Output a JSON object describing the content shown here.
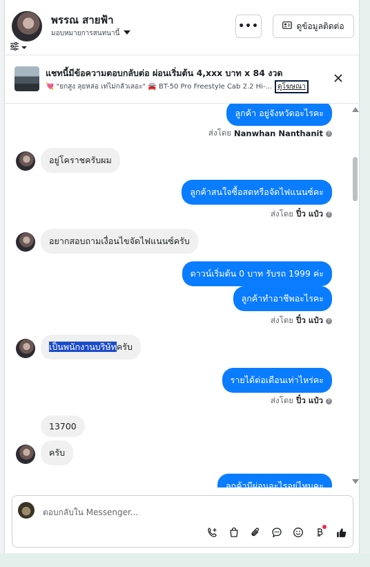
{
  "header": {
    "contact_name": "พรรณ สายฟ้า",
    "assign_label": "มอบหมายการสนทนานี้",
    "more_label": "•••",
    "contact_info_label": "ดูข้อมูลติดต่อ"
  },
  "ad_banner": {
    "title": "แชทนี้มีข้อความตอบกลับต่อ ผ่อนเริ่มต้น 4,xxx บาท x 84 งวด",
    "subtitle": "💘 \"ยกสูง ลุยหล่อ เท่ไม่กลัวเลอะ\" 🚘 BT-50 Pro Freestyle Cab 2.2 Hi-...",
    "link_label": "ดูโฆษณา"
  },
  "messages": {
    "m1": "ลูกค้า อยู่จังหวัดอะไรคะ",
    "s1_prefix": "ส่งโดย",
    "s1_name": "Nanwhan Nanthanit",
    "m2": "อยู่โคราชครับผม",
    "m3": "ลูกค้าสนใจซื้อสดหรือจัดไฟแนนซ์คะ",
    "s2_prefix": "ส่งโดย",
    "s2_name": "ปิ๋ว แป๋ว",
    "m4": "อยากสอบถามเงื่อนไขจัดไฟแนนซ์ครับ",
    "m5": "ดาวน์เริ่มต้น 0 บาท รับรถ 1999 ค่ะ",
    "m6": "ลูกค้าทำอาชีพอะไรคะ",
    "s3_prefix": "ส่งโดย",
    "s3_name": "ปิ๋ว แป๋ว",
    "m7_highlight": "เป็นพนักงานบริษัท",
    "m7_rest": "ครับ",
    "m8": "รายได้ต่อเดือนเท่าไหร่คะ",
    "s4_prefix": "ส่งโดย",
    "s4_name": "ปิ๋ว แป๋ว",
    "m9": "13700",
    "m10": "ครับ",
    "m11": "ลูกค้ามีผ่อนอะไรอยู่ไหมคะ"
  },
  "composer": {
    "placeholder": "ตอบกลับใน Messenger..."
  },
  "colors": {
    "accent": "#0a7cff",
    "incoming_bubble": "#f0f0f0",
    "notification_dot": "#f02849"
  }
}
